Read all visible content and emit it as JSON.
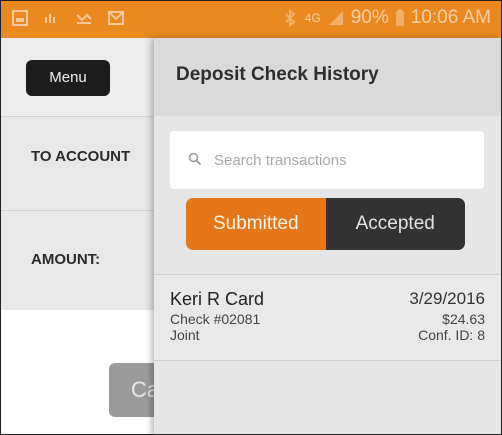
{
  "status_bar": {
    "left_icons": [
      "image-icon",
      "signal-alert-icon",
      "missed-call-icon",
      "mail-icon"
    ],
    "small_label": "4G",
    "battery": "90%",
    "time": "10:06 AM",
    "background_color": "#e9891f"
  },
  "background_app": {
    "menu_label": "Menu",
    "to_account_label": "TO ACCOUNT",
    "amount_label": "AMOUNT:",
    "cancel_label": "Ca"
  },
  "panel": {
    "title": "Deposit Check History",
    "search": {
      "placeholder": "Search transactions",
      "value": ""
    },
    "tabs": [
      {
        "label": "Submitted",
        "selected": true
      },
      {
        "label": "Accepted",
        "selected": false
      }
    ],
    "transactions": [
      {
        "name": "Keri R Card",
        "check": "Check #02081",
        "account": "Joint",
        "date": "3/29/2016",
        "amount": "$24.63",
        "confirmation": "Conf. ID: 8"
      }
    ]
  },
  "colors": {
    "accent": "#e5761a",
    "dark": "#333333"
  }
}
